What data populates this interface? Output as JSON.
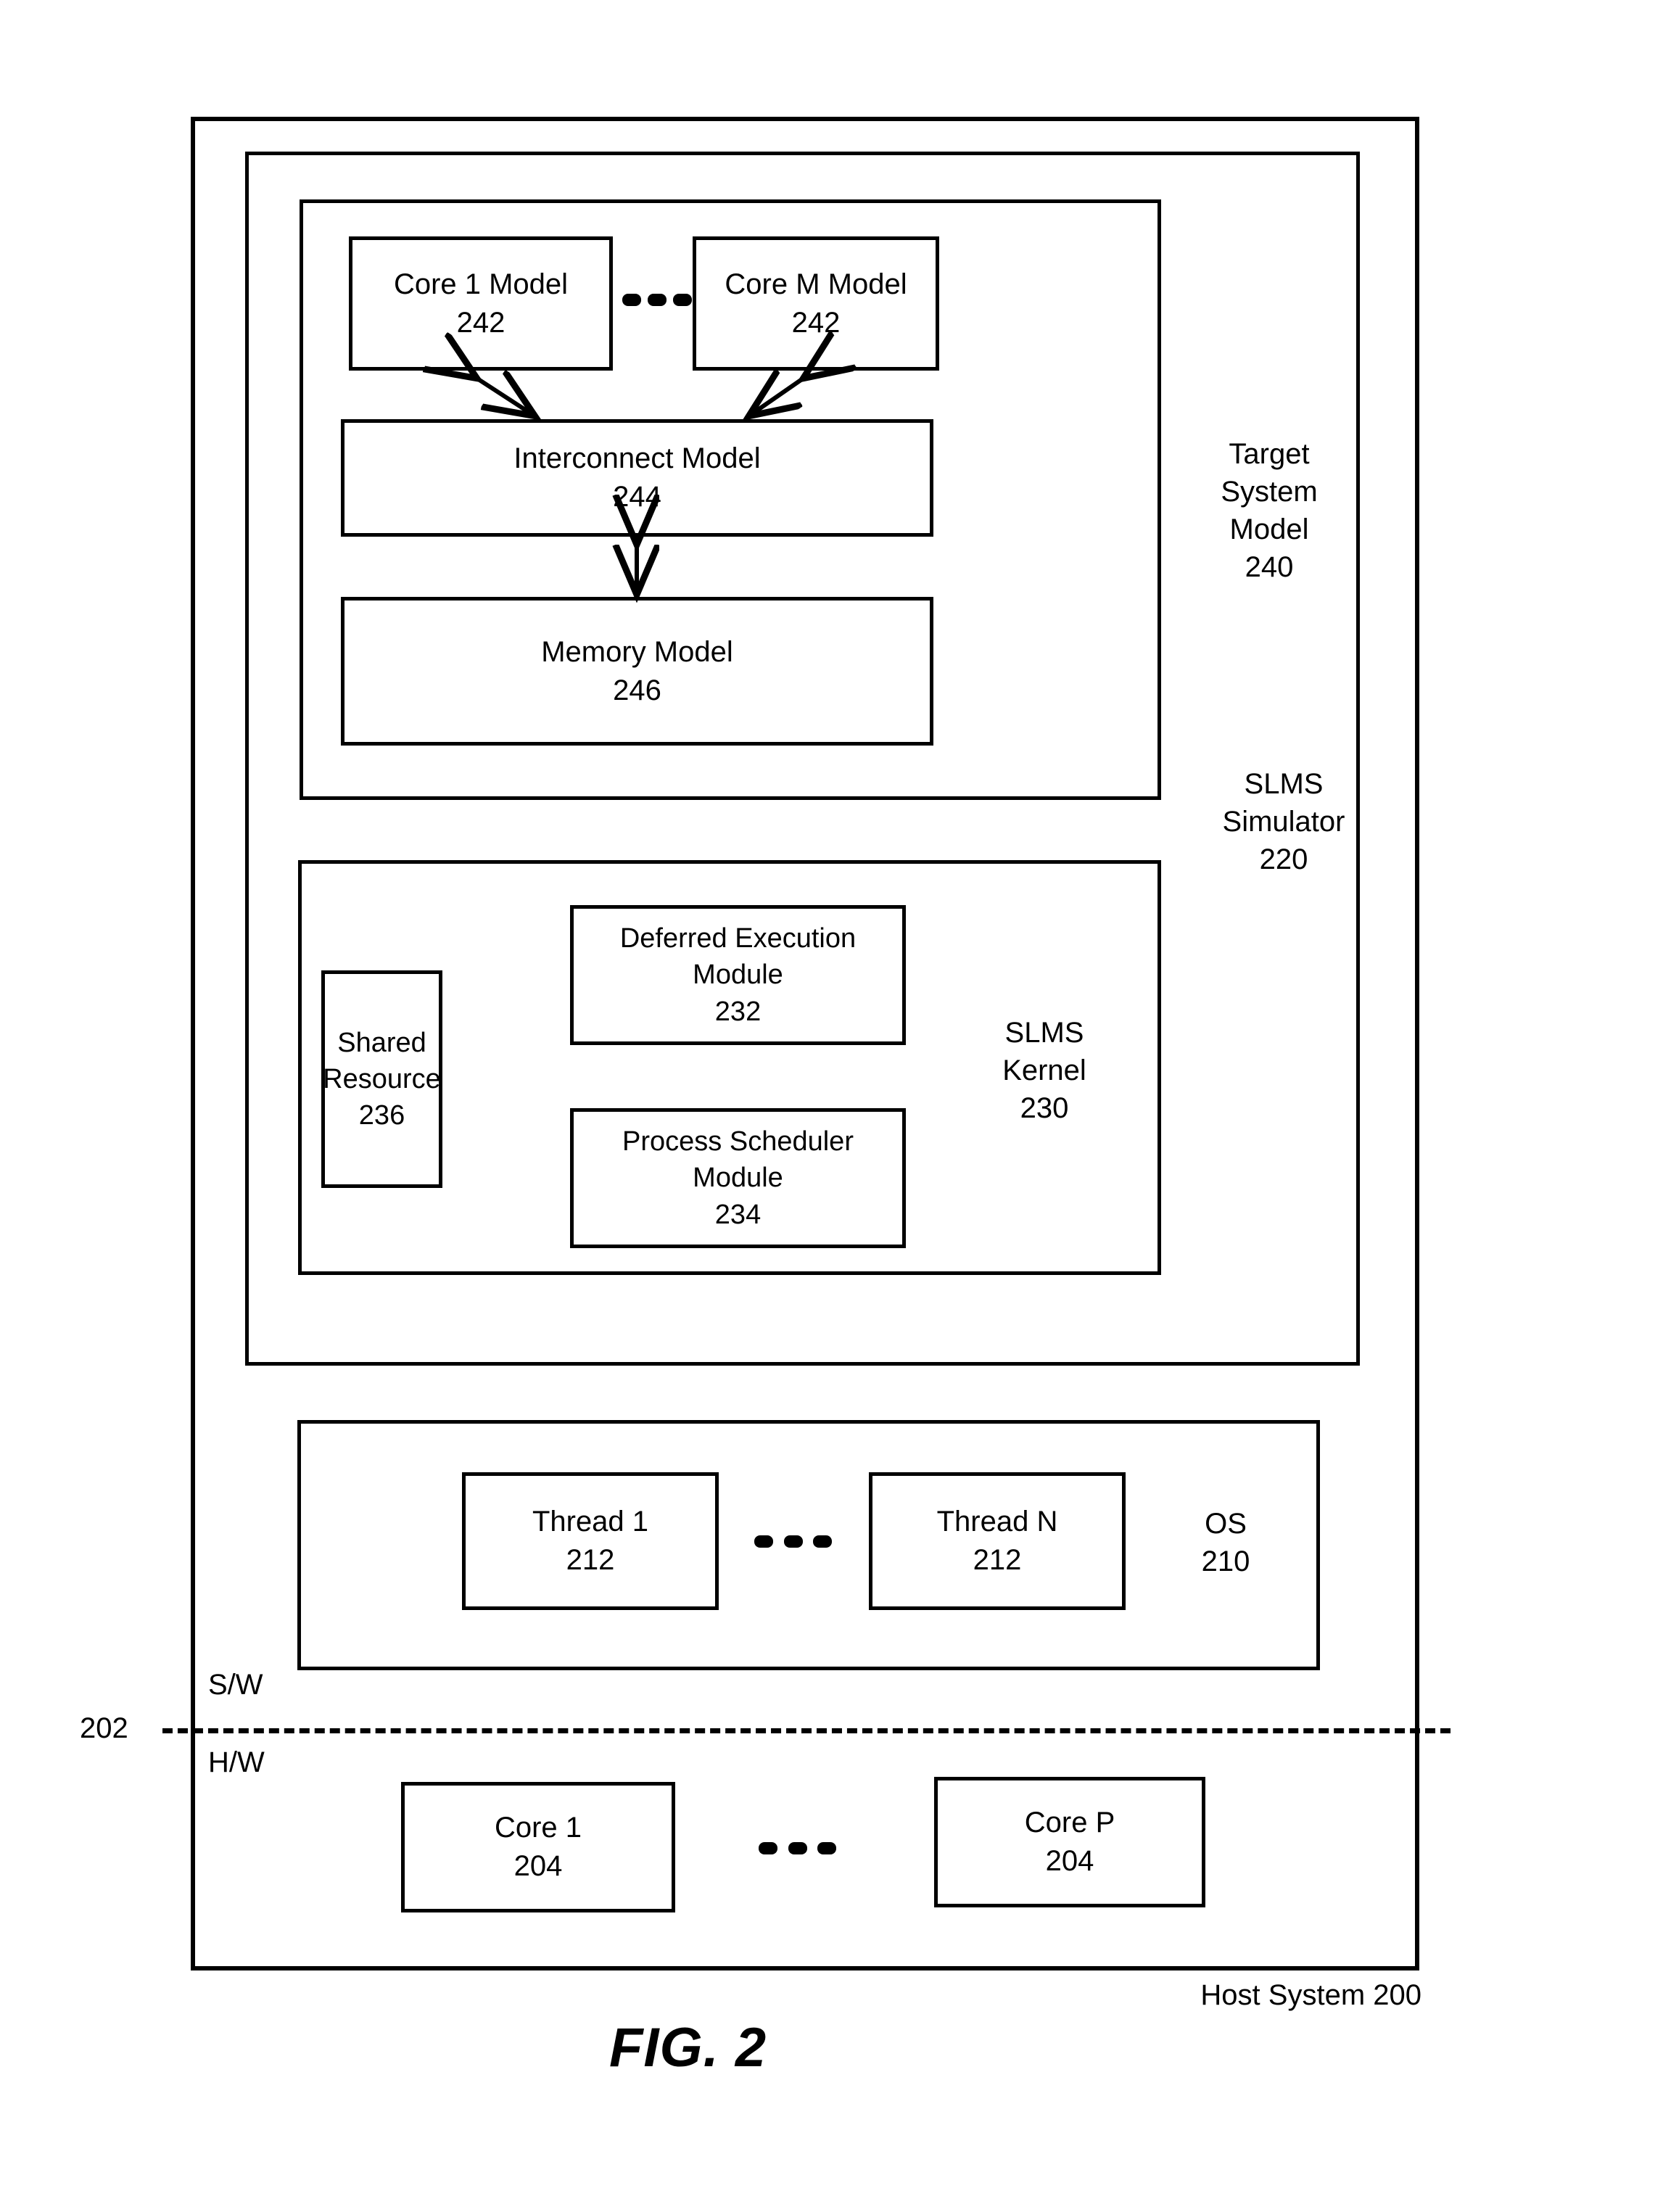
{
  "figure": {
    "caption": "FIG. 2",
    "host_system_label": "Host System 200",
    "boundary_ref": "202",
    "sw_label": "S/W",
    "hw_label": "H/W"
  },
  "simulator": {
    "label": "SLMS\nSimulator\n220"
  },
  "target_system_model": {
    "label": "Target\nSystem\nModel\n240",
    "blocks": [
      {
        "name": "Core 1 Model",
        "ref": "242"
      },
      {
        "name": "Core M Model",
        "ref": "242"
      },
      {
        "name": "Interconnect Model",
        "ref": "244"
      },
      {
        "name": "Memory Model",
        "ref": "246"
      }
    ],
    "ellipsis": "•••"
  },
  "slms_kernel": {
    "label": "SLMS\nKernel\n230",
    "blocks": [
      {
        "name": "Deferred Execution\nModule",
        "ref": "232"
      },
      {
        "name": "Process Scheduler\nModule",
        "ref": "234"
      },
      {
        "name": "Shared\nResource",
        "ref": "236"
      }
    ]
  },
  "os": {
    "label": "OS\n210",
    "blocks": [
      {
        "name": "Thread 1",
        "ref": "212"
      },
      {
        "name": "Thread N",
        "ref": "212"
      }
    ],
    "ellipsis": "•••"
  },
  "hardware": {
    "blocks": [
      {
        "name": "Core 1",
        "ref": "204"
      },
      {
        "name": "Core P",
        "ref": "204"
      }
    ],
    "ellipsis": "•••"
  }
}
